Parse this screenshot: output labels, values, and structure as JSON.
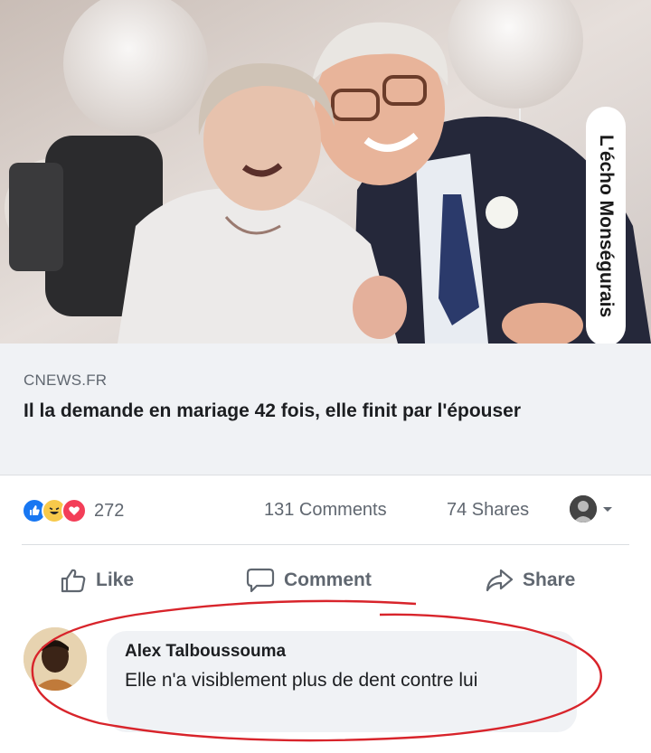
{
  "photo": {
    "watermark": "L'écho Monségurais"
  },
  "link": {
    "source": "CNEWS.FR",
    "title": "Il la demande en mariage 42 fois, elle finit par l'épouser"
  },
  "stats": {
    "reaction_count": "272",
    "comments": "131 Comments",
    "shares": "74 Shares"
  },
  "actions": {
    "like": "Like",
    "comment": "Comment",
    "share": "Share"
  },
  "comment": {
    "author": "Alex Talboussouma",
    "text": "Elle n'a visiblement plus de dent contre lui"
  },
  "colors": {
    "like_blue": "#1877f2",
    "haha_yellow": "#f7c94b",
    "love_red": "#f33e58",
    "highlight_red": "#d8242b"
  }
}
